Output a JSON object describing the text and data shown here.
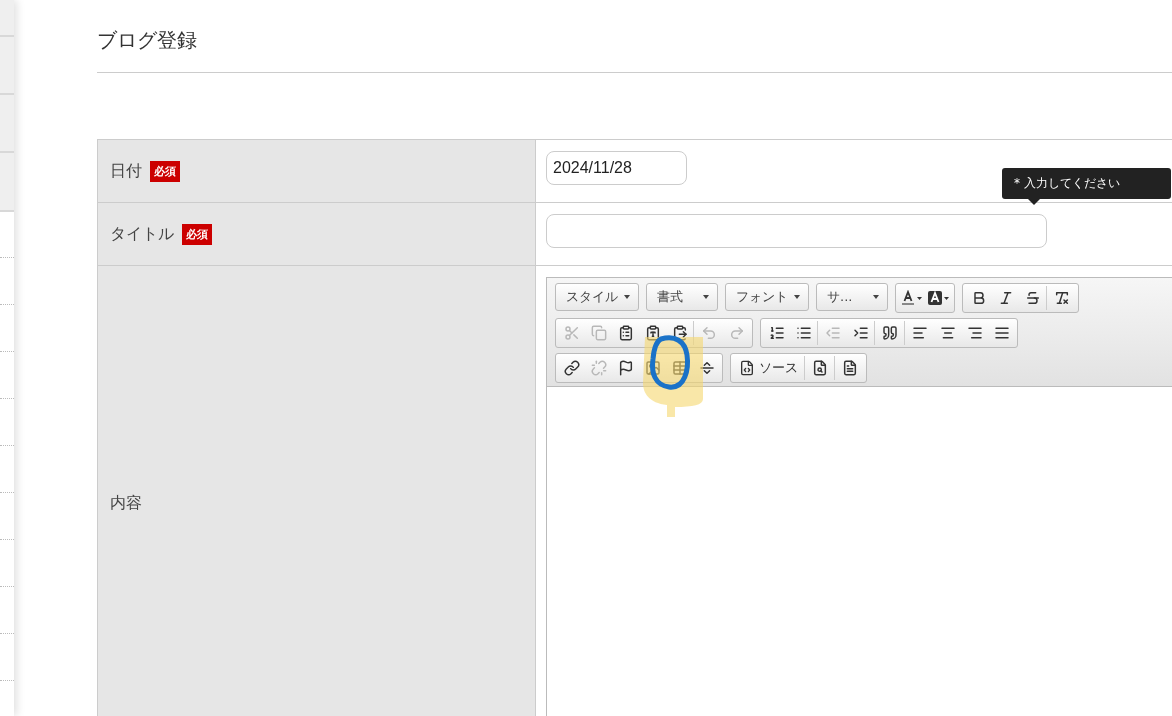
{
  "page": {
    "title": "ブログ登録"
  },
  "form": {
    "rows": [
      {
        "kind": "date",
        "label": "日付",
        "required_badge": "必須",
        "value": "2024/11/28"
      },
      {
        "kind": "text",
        "label": "タイトル",
        "required_badge": "必須",
        "value": "",
        "tooltip": "* 入力してください"
      },
      {
        "kind": "editor",
        "label": "内容"
      }
    ]
  },
  "toolbar": {
    "rows": [
      {
        "groups": [
          {
            "items": [
              {
                "kind": "combo",
                "label": "スタイル"
              }
            ]
          },
          {
            "items": [
              {
                "kind": "combo",
                "label": "書式"
              }
            ]
          },
          {
            "items": [
              {
                "kind": "combo",
                "label": "フォント"
              }
            ]
          },
          {
            "items": [
              {
                "kind": "combo",
                "label": "サ..."
              }
            ]
          },
          {
            "items": [
              {
                "kind": "icon",
                "disabled": false,
                "separator": false
              },
              {
                "kind": "icon",
                "disabled": false,
                "separator": false
              }
            ]
          },
          {
            "items": [
              {
                "kind": "icon",
                "disabled": false,
                "separator": false
              },
              {
                "kind": "icon",
                "disabled": false,
                "separator": false
              },
              {
                "kind": "icon",
                "disabled": false,
                "separator": false
              },
              {
                "kind": "icon",
                "disabled": false,
                "separator": true
              }
            ]
          }
        ]
      },
      {
        "groups": [
          {
            "items": [
              {
                "kind": "icon",
                "disabled": true,
                "separator": false
              },
              {
                "kind": "icon",
                "disabled": true,
                "separator": false
              },
              {
                "kind": "icon",
                "disabled": false,
                "separator": false
              },
              {
                "kind": "icon",
                "disabled": false,
                "separator": false
              },
              {
                "kind": "icon",
                "disabled": false,
                "separator": false
              },
              {
                "kind": "icon",
                "disabled": true,
                "separator": true
              },
              {
                "kind": "icon",
                "disabled": true,
                "separator": false
              }
            ]
          },
          {
            "items": [
              {
                "kind": "icon",
                "disabled": false,
                "separator": false
              },
              {
                "kind": "icon",
                "disabled": false,
                "separator": false
              },
              {
                "kind": "icon",
                "disabled": true,
                "separator": true
              },
              {
                "kind": "icon",
                "disabled": false,
                "separator": false
              },
              {
                "kind": "icon",
                "disabled": false,
                "separator": true
              },
              {
                "kind": "icon",
                "disabled": false,
                "separator": true
              },
              {
                "kind": "icon",
                "disabled": false,
                "separator": false
              },
              {
                "kind": "icon",
                "disabled": false,
                "separator": false
              },
              {
                "kind": "icon",
                "disabled": false,
                "separator": false
              }
            ]
          }
        ]
      },
      {
        "groups": [
          {
            "items": [
              {
                "kind": "icon",
                "disabled": false,
                "separator": false
              },
              {
                "kind": "icon",
                "disabled": true,
                "separator": false
              },
              {
                "kind": "icon",
                "disabled": false,
                "separator": false
              },
              {
                "kind": "icon",
                "disabled": false,
                "separator": false
              },
              {
                "kind": "icon",
                "disabled": false,
                "separator": false
              },
              {
                "kind": "icon",
                "disabled": false,
                "separator": false
              }
            ]
          },
          {
            "items": [
              {
                "kind": "text",
                "label": "ソース",
                "separator": false
              },
              {
                "kind": "icon",
                "disabled": false,
                "separator": true
              },
              {
                "kind": "icon",
                "disabled": false,
                "separator": true
              }
            ]
          }
        ]
      }
    ]
  },
  "annotation": {
    "kind": "circle"
  }
}
